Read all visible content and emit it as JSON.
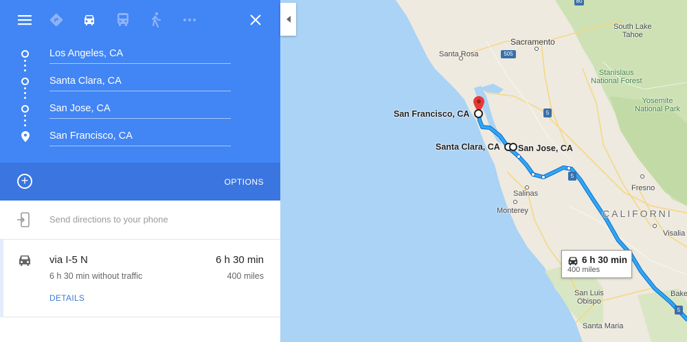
{
  "panel": {
    "waypoints": [
      {
        "label": "Los Angeles, CA"
      },
      {
        "label": "Santa Clara, CA"
      },
      {
        "label": "San Jose, CA"
      },
      {
        "label": "San Francisco, CA"
      }
    ],
    "options_label": "OPTIONS",
    "send_directions": "Send directions to your phone",
    "route": {
      "via": "via I-5 N",
      "duration": "6 h 30 min",
      "subtitle": "6 h 30 min without traffic",
      "distance": "400 miles",
      "details_label": "DETAILS"
    },
    "colors": {
      "panel_blue": "#4285f4",
      "options_blue": "#3a75e0",
      "route_blue": "#2ea8f2",
      "land": "#eeeadf",
      "water": "#aad3f5",
      "forest": "#cde1b5"
    }
  },
  "map": {
    "labels": {
      "santa_rosa": "Santa Rosa",
      "sacramento": "Sacramento",
      "south_lake_tahoe": "South Lake\nTahoe",
      "stanislaus": "Stanislaus\nNational Forest",
      "yosemite": "Yosemite\nNational Park",
      "san_francisco": "San Francisco, CA",
      "santa_clara": "Santa Clara, CA",
      "san_jose": "San Jose, CA",
      "salinas": "Salinas",
      "monterey": "Monterey",
      "fresno": "Fresno",
      "california": "CALIFORNI",
      "visalia": "Visalia",
      "san_luis_obispo": "San Luis\nObispo",
      "santa_maria": "Santa Maria",
      "bake": "Bake"
    },
    "highway_shields": [
      "80",
      "505",
      "5",
      "5",
      "5"
    ],
    "route_box": {
      "duration": "6 h 30 min",
      "distance": "400 miles"
    }
  }
}
